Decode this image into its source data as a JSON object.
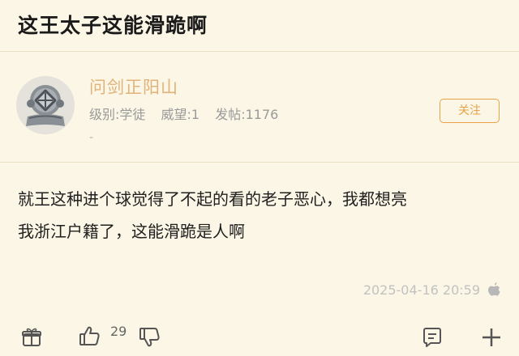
{
  "thread": {
    "title": "这王太子这能滑跪啊"
  },
  "author": {
    "name": "问剑正阳山",
    "level_label": "级别:",
    "level_value": "学徒",
    "prestige_label": "威望:",
    "prestige_value": "1",
    "posts_label": "发帖:",
    "posts_value": "1176",
    "signature": "-",
    "follow_label": "关注"
  },
  "post": {
    "line1": "就王这种进个球觉得了不起的看的老子恶心，我都想亮",
    "line2": "我浙江户籍了，这能滑跪是人啊",
    "timestamp": "2025-04-16 20:59"
  },
  "actions": {
    "like_count": "29",
    "icons": [
      "gift-icon",
      "thumbs-up-icon",
      "thumbs-down-icon",
      "comment-icon",
      "plus-icon"
    ]
  },
  "colors": {
    "background": "#fbf6e5",
    "accent": "#e8a247",
    "author_name": "#e0b37a"
  }
}
